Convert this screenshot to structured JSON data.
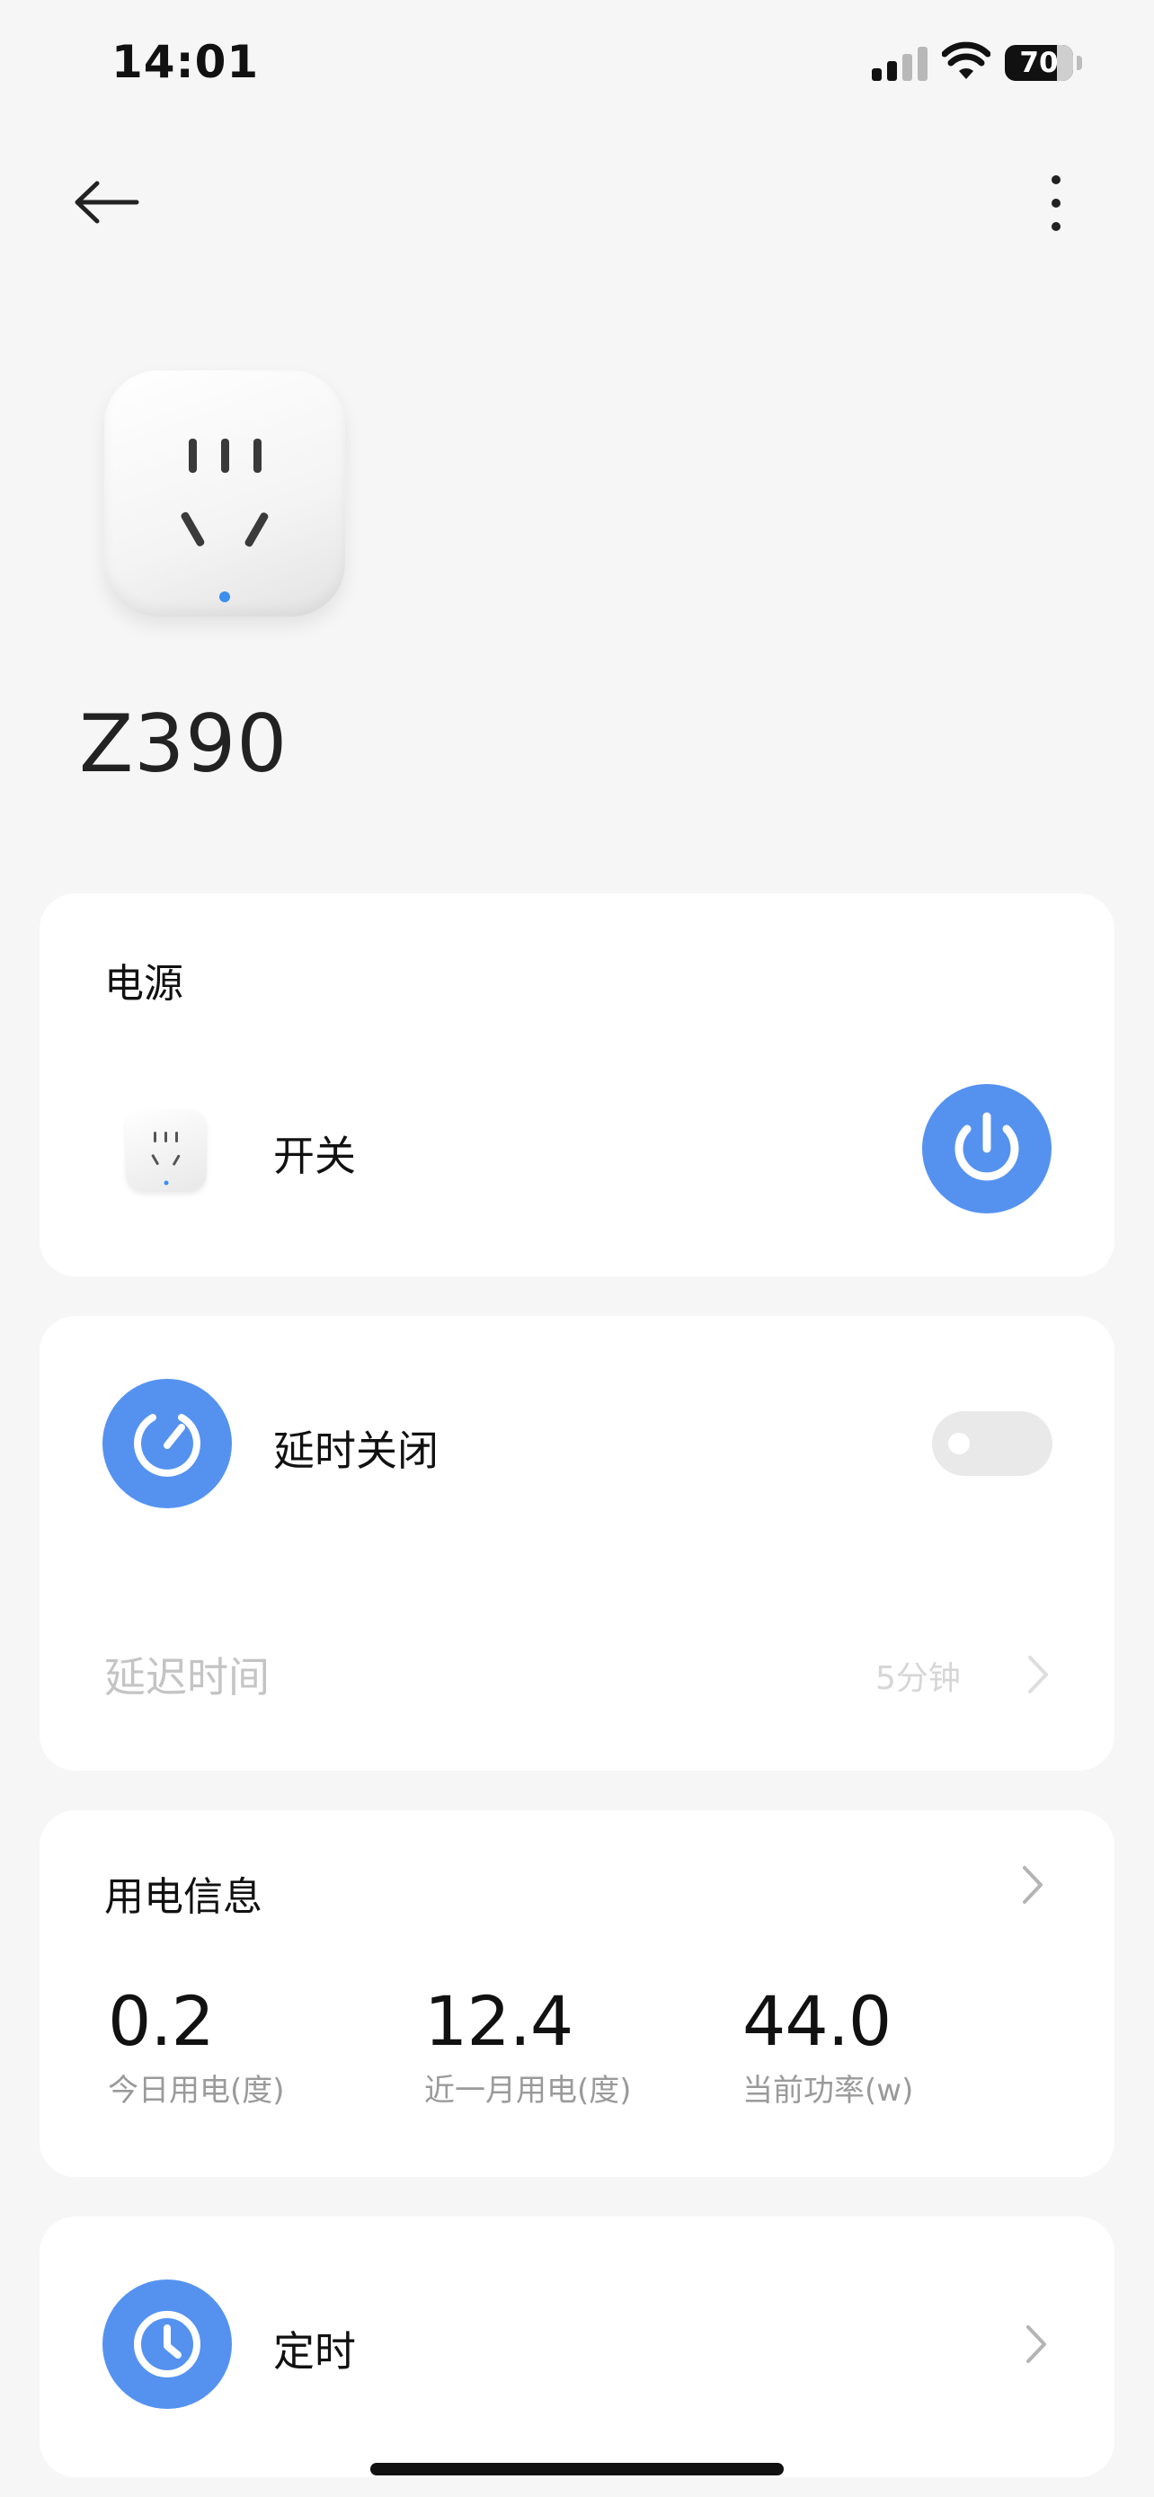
{
  "status_bar": {
    "time": "14:01",
    "battery": "70",
    "icons": [
      "cellular-signal-icon",
      "wifi-icon",
      "battery-icon"
    ]
  },
  "header": {
    "back_icon": "back-arrow-icon",
    "more_icon": "more-vertical-icon"
  },
  "device": {
    "name": "Z390",
    "image": "smart-plug-image"
  },
  "power_card": {
    "title": "电源",
    "switch_label": "开关",
    "power_state": "on",
    "accent_color": "#5592f0"
  },
  "delay_card": {
    "label": "延时关闭",
    "toggle_on": false,
    "delay_label": "延迟时间",
    "delay_value": "5分钟"
  },
  "energy_card": {
    "title": "用电信息",
    "stats": [
      {
        "value": "0.2",
        "label": "今日用电(度)"
      },
      {
        "value": "12.4",
        "label": "近一月用电(度)"
      },
      {
        "value": "44.0",
        "label": "当前功率(w)"
      }
    ]
  },
  "schedule_card": {
    "label": "定时"
  }
}
